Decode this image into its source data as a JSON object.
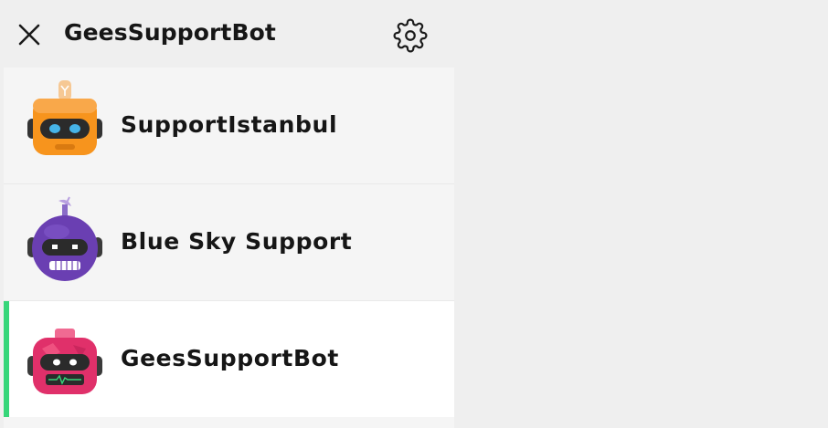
{
  "header": {
    "title": "GeesSupportBot",
    "close_icon": "close-icon",
    "settings_icon": "gear-icon"
  },
  "bots": [
    {
      "label": "SupportIstanbul",
      "avatar": "orange-robot-avatar",
      "active": false
    },
    {
      "label": "Blue Sky Support",
      "avatar": "purple-robot-avatar",
      "active": false
    },
    {
      "label": "GeesSupportBot",
      "avatar": "pink-robot-avatar",
      "active": true
    }
  ],
  "colors": {
    "active_indicator": "#37d67a",
    "item_background": "#f5f5f5",
    "active_item_background": "#ffffff",
    "page_background": "#efefef",
    "orange_robot": "#f7941d",
    "purple_robot": "#6a3fb2",
    "pink_robot": "#e0306a"
  }
}
